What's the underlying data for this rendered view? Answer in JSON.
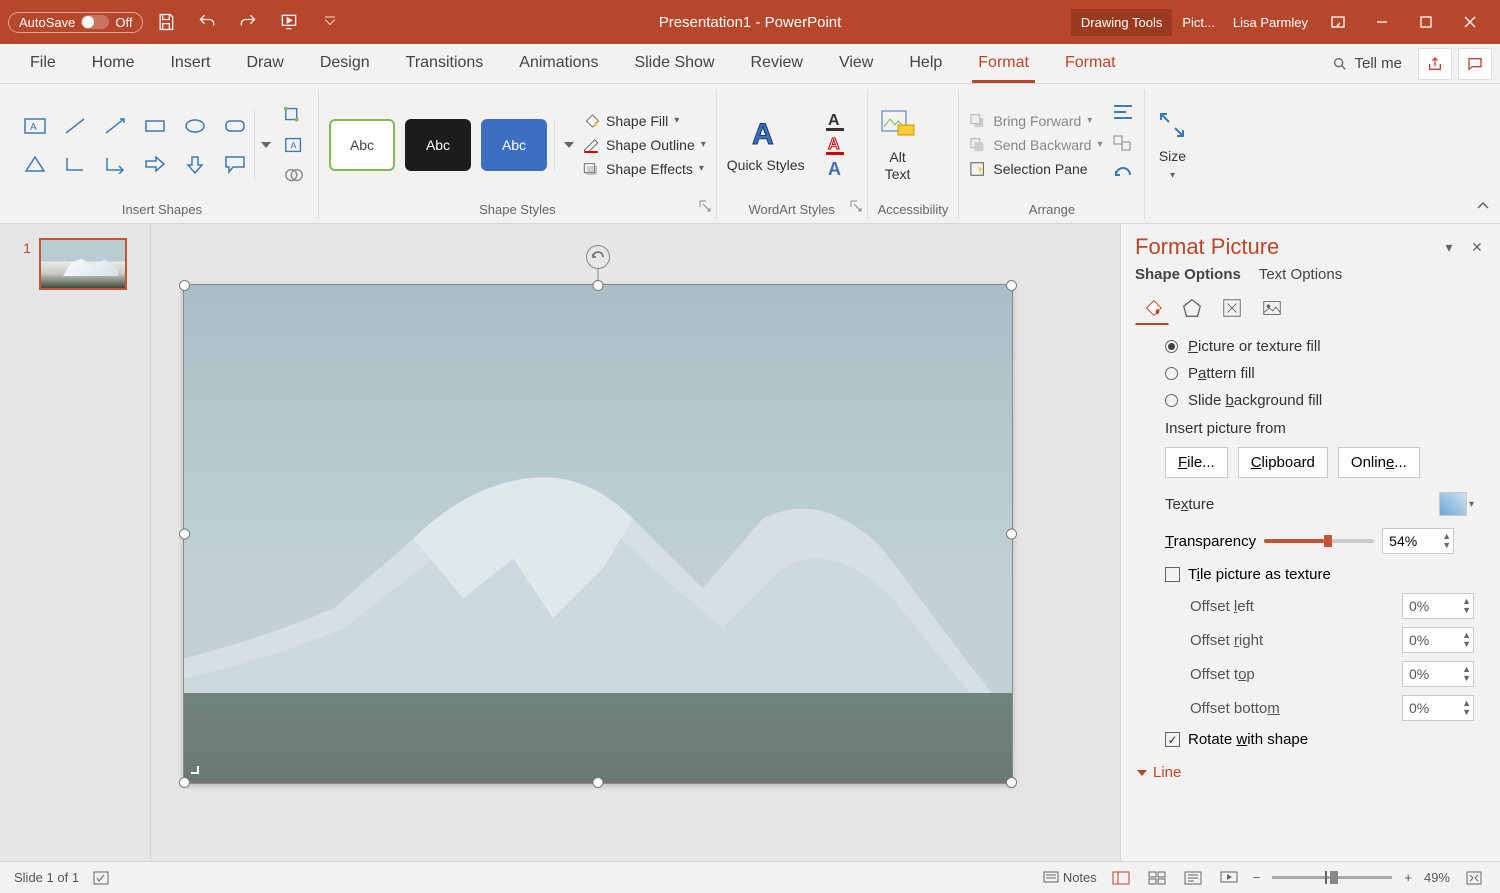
{
  "title": "Presentation1  -  PowerPoint",
  "autosave": {
    "label": "AutoSave",
    "state": "Off"
  },
  "context_tools": {
    "drawing": "Drawing Tools",
    "picture": "Pict..."
  },
  "user": "Lisa Parmley",
  "tabs": [
    "File",
    "Home",
    "Insert",
    "Draw",
    "Design",
    "Transitions",
    "Animations",
    "Slide Show",
    "Review",
    "View",
    "Help",
    "Format",
    "Format"
  ],
  "tell_me": "Tell me",
  "ribbon": {
    "insert_shapes": "Insert Shapes",
    "shape_styles": "Shape Styles",
    "wordart_styles": "WordArt Styles",
    "accessibility": "Accessibility",
    "arrange": "Arrange",
    "size": "Size",
    "preset_label": "Abc",
    "shape_fill": "Shape Fill",
    "shape_outline": "Shape Outline",
    "shape_effects": "Shape Effects",
    "quick_styles": "Quick Styles",
    "alt_text": "Alt Text",
    "bring_forward": "Bring Forward",
    "send_backward": "Send Backward",
    "selection_pane": "Selection Pane"
  },
  "pane": {
    "title": "Format Picture",
    "shape_options": "Shape Options",
    "text_options": "Text Options",
    "fill": {
      "picture_texture": "Picture or texture fill",
      "pattern": "Pattern fill",
      "slide_bg": "Slide background fill"
    },
    "insert_from": "Insert picture from",
    "file_btn": "File...",
    "clipboard_btn": "Clipboard",
    "online_btn": "Online...",
    "texture": "Texture",
    "transparency": "Transparency",
    "transparency_value": "54%",
    "tile": "Tile picture as texture",
    "offset_left": "Offset left",
    "offset_right": "Offset right",
    "offset_top": "Offset top",
    "offset_bottom": "Offset bottom",
    "offset_value": "0%",
    "rotate": "Rotate with shape",
    "line": "Line"
  },
  "status": {
    "slide": "Slide 1 of 1",
    "notes": "Notes",
    "zoom": "49%"
  },
  "thumb_number": "1"
}
